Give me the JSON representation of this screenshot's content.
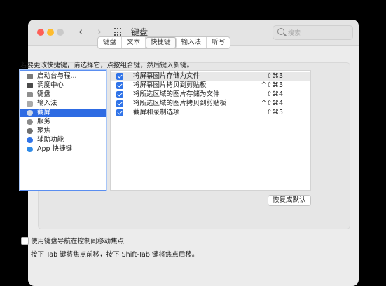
{
  "window": {
    "title": "键盘",
    "search_placeholder": "搜索"
  },
  "tabs": [
    {
      "label": "键盘",
      "active": false
    },
    {
      "label": "文本",
      "active": false
    },
    {
      "label": "快捷键",
      "active": true
    },
    {
      "label": "输入法",
      "active": false
    },
    {
      "label": "听写",
      "active": false
    }
  ],
  "instruction": "若要更改快捷键，请选择它，点按组合键，然后键入新键。",
  "categories": [
    {
      "label": "启动台与程...",
      "icon": "launchpad-icon",
      "color": "#7a7a7a",
      "selected": false
    },
    {
      "label": "调度中心",
      "icon": "mission-control-icon",
      "color": "#4a4a4a",
      "selected": false
    },
    {
      "label": "键盘",
      "icon": "keyboard-icon",
      "color": "#8e8e8e",
      "selected": false
    },
    {
      "label": "输入法",
      "icon": "input-method-icon",
      "color": "#aaaaaa",
      "selected": false
    },
    {
      "label": "截屏",
      "icon": "screenshot-icon",
      "color": "#cfd8e8",
      "selected": true
    },
    {
      "label": "服务",
      "icon": "gear-icon",
      "color": "#8a8a8a",
      "selected": false
    },
    {
      "label": "聚焦",
      "icon": "spotlight-icon",
      "color": "#6f6f6f",
      "selected": false
    },
    {
      "label": "辅助功能",
      "icon": "accessibility-icon",
      "color": "#2f73e8",
      "selected": false
    },
    {
      "label": "App 快捷键",
      "icon": "app-store-icon",
      "color": "#2f8be8",
      "selected": false
    }
  ],
  "shortcuts": [
    {
      "label": "将屏幕图片存储为文件",
      "key": "⇧⌘3",
      "checked": true
    },
    {
      "label": "将屏幕图片拷贝到剪贴板",
      "key": "^⇧⌘3",
      "checked": true
    },
    {
      "label": "将所选区域的图片存储为文件",
      "key": "⇧⌘4",
      "checked": true
    },
    {
      "label": "将所选区域的图片拷贝到剪贴板",
      "key": "^⇧⌘4",
      "checked": true
    },
    {
      "label": "截屏和录制选项",
      "key": "⇧⌘5",
      "checked": true
    }
  ],
  "restore_button": "恢复成默认",
  "keyboard_nav_label": "使用键盘导航在控制间移动焦点",
  "keyboard_nav_hint": "按下 Tab 键将焦点前移，按下 Shift-Tab 键将焦点后移。"
}
